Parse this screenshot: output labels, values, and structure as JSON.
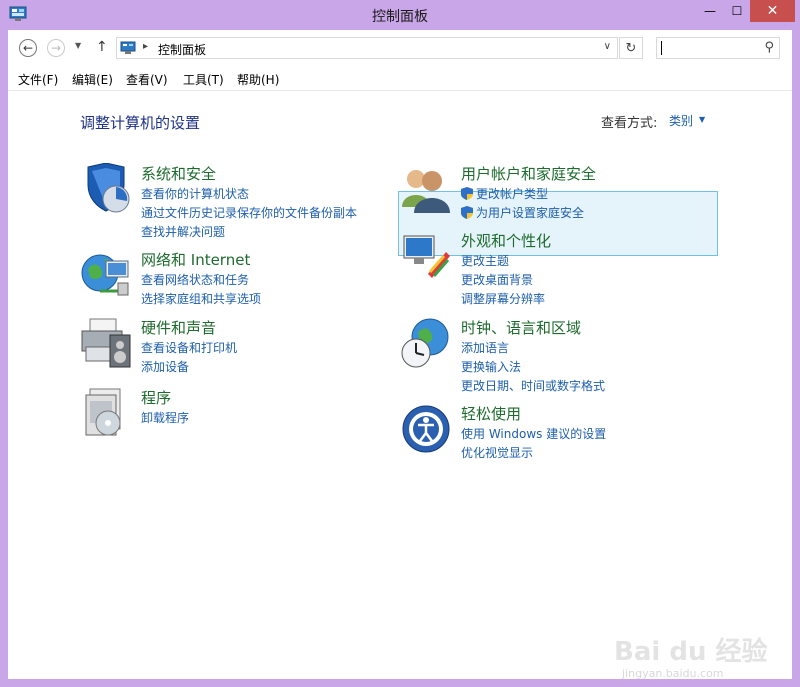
{
  "window": {
    "title": "控制面板",
    "min_glyph": "—",
    "max_glyph": "☐",
    "close_glyph": "✕"
  },
  "address": {
    "back_glyph": "←",
    "forward_glyph": "→",
    "recent_glyph": "▼",
    "up_glyph": "↑",
    "separator": "▸",
    "path": "控制面板",
    "dropdown_glyph": "∨",
    "refresh_glyph": "↻",
    "search_placeholder": "",
    "search_glyph": "⚲"
  },
  "menu": {
    "file": "文件(F)",
    "edit": "编辑(E)",
    "view": "查看(V)",
    "tools": "工具(T)",
    "help": "帮助(H)"
  },
  "main": {
    "title": "调整计算机的设置",
    "view_by_label": "查看方式:",
    "view_by_value": "类别",
    "view_by_arrow": "▼"
  },
  "categories": [
    {
      "title": "系统和安全",
      "links": [
        "查看你的计算机状态",
        "通过文件历史记录保存你的文件备份副本",
        "查找并解决问题"
      ],
      "icon": "system-security-icon"
    },
    {
      "title": "网络和 Internet",
      "links": [
        "查看网络状态和任务",
        "选择家庭组和共享选项"
      ],
      "icon": "network-icon"
    },
    {
      "title": "硬件和声音",
      "links": [
        "查看设备和打印机",
        "添加设备"
      ],
      "icon": "hardware-sound-icon"
    },
    {
      "title": "程序",
      "links": [
        "卸载程序"
      ],
      "icon": "programs-icon"
    },
    {
      "title": "用户帐户和家庭安全",
      "links": [
        "更改帐户类型",
        "为用户设置家庭安全"
      ],
      "icon": "user-accounts-icon"
    },
    {
      "title": "外观和个性化",
      "links": [
        "更改主题",
        "更改桌面背景",
        "调整屏幕分辨率"
      ],
      "icon": "appearance-icon"
    },
    {
      "title": "时钟、语言和区域",
      "links": [
        "添加语言",
        "更换输入法",
        "更改日期、时间或数字格式"
      ],
      "icon": "clock-region-icon"
    },
    {
      "title": "轻松使用",
      "links": [
        "使用 Windows 建议的设置",
        "优化视觉显示"
      ],
      "icon": "ease-of-access-icon"
    }
  ],
  "watermark": {
    "main": "Bai du 经验",
    "sub": "jingyan.baidu.com"
  },
  "colors": {
    "title_bar": "#c9a6e8",
    "close_button": "#c7504f",
    "category_title": "#1e6b2e",
    "link": "#1e5fab",
    "highlight": "#e5f3fb"
  }
}
